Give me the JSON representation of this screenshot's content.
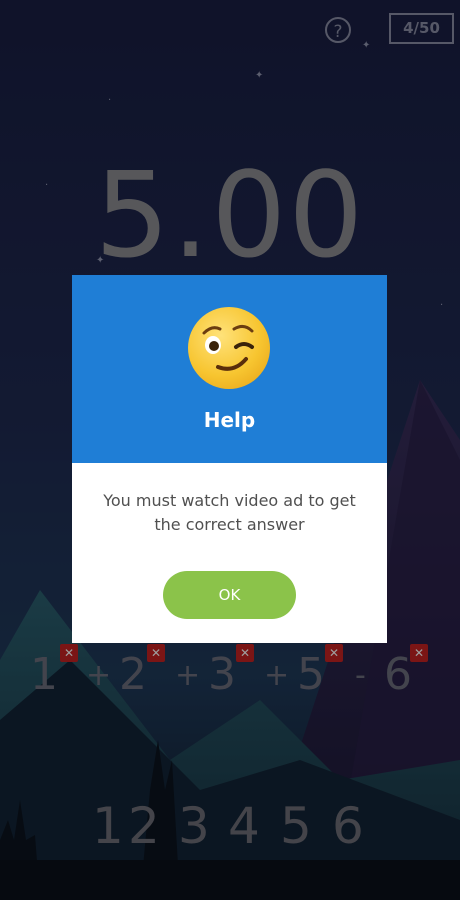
{
  "header": {
    "help_icon_glyph": "?",
    "level_progress": "4/50"
  },
  "game": {
    "target_value": "5.00",
    "equation": {
      "numbers": [
        "1",
        "2",
        "3",
        "5",
        "6"
      ],
      "operators": [
        "+",
        "+",
        "+",
        "-"
      ],
      "remove_glyph": "✕"
    },
    "digit_pool": [
      "1",
      "2",
      "3",
      "4",
      "5",
      "6"
    ]
  },
  "dialog": {
    "title": "Help",
    "message": "You must watch video ad to get the correct answer",
    "ok_label": "OK",
    "emoji_icon": "winking-face-icon"
  },
  "colors": {
    "dialog_header": "#1f7ed6",
    "ok_button": "#8bc34a",
    "remove_badge": "#c72222"
  }
}
